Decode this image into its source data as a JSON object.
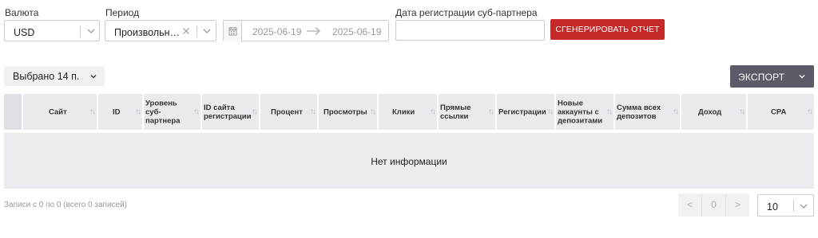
{
  "filters": {
    "currency_label": "Валюта",
    "currency_value": "USD",
    "period_label": "Период",
    "period_value": "Произвольн…",
    "date_from": "2025-06-19",
    "date_to": "2025-06-19",
    "subpartner_label": "Дата регистрации суб-партнера",
    "subpartner_value": "",
    "generate_label": "СГЕНЕРИРОВАТЬ ОТЧЕТ"
  },
  "toolbar": {
    "columns_selected": "Выбрано 14 п.",
    "export_label": "ЭКСПОРТ"
  },
  "table": {
    "columns": [
      "",
      "Сайт",
      "ID",
      "Уровень суб-партнера",
      "ID сайта регистрации",
      "Процент",
      "Просмотры",
      "Клики",
      "Прямые ссылки",
      "Регистрации",
      "Новые аккаунты с депозитами",
      "Сумма всех депозитов",
      "Доход",
      "CPA"
    ],
    "empty_text": "Нет информации"
  },
  "footer": {
    "info": "Записи с 0 по 0 (всего 0 записей)",
    "prev": "<",
    "page": "0",
    "next": ">",
    "page_size": "10"
  },
  "colors": {
    "accent": "#c62828",
    "export_bg": "#5a5b67",
    "header_bg": "#e9eaee"
  }
}
